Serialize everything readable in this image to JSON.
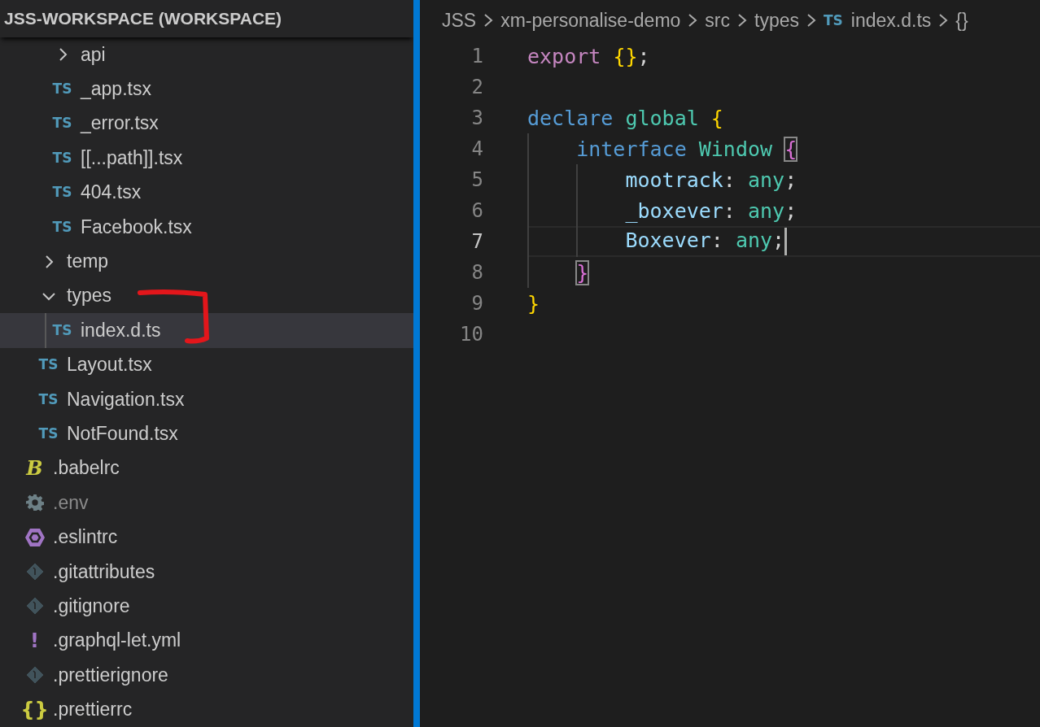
{
  "explorer": {
    "title": "JSS-WORKSPACE (WORKSPACE)",
    "tree": [
      {
        "children": [
          {
            "children": [
              {
                "label": "api",
                "kind": "folder",
                "expanded": false,
                "selected": false,
                "dimmed": false
              },
              {
                "label": "_app.tsx",
                "kind": "file",
                "icon": {
                  "kind": "ts",
                  "glyph": "TS"
                },
                "selected": false,
                "dimmed": false
              },
              {
                "label": "_error.tsx",
                "kind": "file",
                "icon": {
                  "kind": "ts",
                  "glyph": "TS"
                },
                "selected": false,
                "dimmed": false
              },
              {
                "label": "[[...path]].tsx",
                "kind": "file",
                "icon": {
                  "kind": "ts",
                  "glyph": "TS"
                },
                "selected": false,
                "dimmed": false
              },
              {
                "label": "404.tsx",
                "kind": "file",
                "icon": {
                  "kind": "ts",
                  "glyph": "TS"
                },
                "selected": false,
                "dimmed": false
              },
              {
                "label": "Facebook.tsx",
                "kind": "file",
                "icon": {
                  "kind": "ts",
                  "glyph": "TS"
                },
                "selected": false,
                "dimmed": false
              }
            ]
          },
          {
            "label": "temp",
            "kind": "folder",
            "expanded": false,
            "selected": false,
            "dimmed": false
          },
          {
            "label": "types",
            "kind": "folder",
            "expanded": true,
            "selected": false,
            "dimmed": false,
            "children": [
              {
                "label": "index.d.ts",
                "kind": "file",
                "icon": {
                  "kind": "ts",
                  "glyph": "TS"
                },
                "selected": true,
                "dimmed": false
              }
            ]
          },
          {
            "label": "Layout.tsx",
            "kind": "file",
            "icon": {
              "kind": "ts",
              "glyph": "TS"
            },
            "selected": false,
            "dimmed": false
          },
          {
            "label": "Navigation.tsx",
            "kind": "file",
            "icon": {
              "kind": "ts",
              "glyph": "TS"
            },
            "selected": false,
            "dimmed": false
          },
          {
            "label": "NotFound.tsx",
            "kind": "file",
            "icon": {
              "kind": "ts",
              "glyph": "TS"
            },
            "selected": false,
            "dimmed": false
          }
        ]
      },
      {
        "label": ".babelrc",
        "kind": "file",
        "icon": {
          "kind": "babel",
          "glyph": "B"
        },
        "selected": false,
        "dimmed": false
      },
      {
        "label": ".env",
        "kind": "file",
        "icon": {
          "kind": "gear"
        },
        "selected": false,
        "dimmed": true
      },
      {
        "label": ".eslintrc",
        "kind": "file",
        "icon": {
          "kind": "eslint"
        },
        "selected": false,
        "dimmed": false
      },
      {
        "label": ".gitattributes",
        "kind": "file",
        "icon": {
          "kind": "git"
        },
        "selected": false,
        "dimmed": false
      },
      {
        "label": ".gitignore",
        "kind": "file",
        "icon": {
          "kind": "git"
        },
        "selected": false,
        "dimmed": false
      },
      {
        "label": ".graphql-let.yml",
        "kind": "file",
        "icon": {
          "kind": "yaml",
          "glyph": "!"
        },
        "selected": false,
        "dimmed": false
      },
      {
        "label": ".prettierignore",
        "kind": "file",
        "icon": {
          "kind": "git"
        },
        "selected": false,
        "dimmed": false
      },
      {
        "label": ".prettierrc",
        "kind": "file",
        "icon": {
          "kind": "json",
          "glyph": "{}"
        },
        "selected": false,
        "dimmed": false
      }
    ]
  },
  "editor": {
    "breadcrumbs": [
      {
        "label": "JSS"
      },
      {
        "label": "xm-personalise-demo"
      },
      {
        "label": "src"
      },
      {
        "label": "types"
      },
      {
        "label": "index.d.ts",
        "icon": {
          "kind": "ts",
          "glyph": "TS"
        }
      },
      {
        "label": "{}"
      }
    ],
    "lines": [
      {
        "number": "1",
        "current": false,
        "tokens": [
          {
            "text": "export",
            "kind": "control"
          },
          {
            "text": " {}",
            "kind": "brace1"
          },
          {
            "text": ";",
            "kind": "plain"
          }
        ]
      },
      {
        "number": "2",
        "current": false
      },
      {
        "number": "3",
        "current": false,
        "tokens": [
          {
            "text": "declare",
            "kind": "keyword"
          },
          {
            "text": " global",
            "kind": "type"
          },
          {
            "text": " {",
            "kind": "brace1"
          }
        ]
      },
      {
        "number": "4",
        "current": false,
        "tokens": [
          {
            "text": "    interface",
            "kind": "keyword"
          },
          {
            "text": " Window",
            "kind": "type"
          },
          {
            "text": " {",
            "kind": "brace2_matched"
          }
        ]
      },
      {
        "number": "5",
        "current": false,
        "tokens": [
          {
            "text": "        mootrack",
            "kind": "property"
          },
          {
            "text": ":",
            "kind": "plain"
          },
          {
            "text": " any",
            "kind": "type"
          },
          {
            "text": ";",
            "kind": "plain"
          }
        ]
      },
      {
        "number": "6",
        "current": false,
        "tokens": [
          {
            "text": "        _boxever",
            "kind": "property"
          },
          {
            "text": ":",
            "kind": "plain"
          },
          {
            "text": " any",
            "kind": "type"
          },
          {
            "text": ";",
            "kind": "plain"
          }
        ]
      },
      {
        "number": "7",
        "current": true,
        "tokens": [
          {
            "text": "        Boxever",
            "kind": "property"
          },
          {
            "text": ":",
            "kind": "plain"
          },
          {
            "text": " any",
            "kind": "type"
          },
          {
            "text": ";",
            "kind": "plain"
          }
        ]
      },
      {
        "number": "8",
        "current": false,
        "tokens": [
          {
            "text": "    }",
            "kind": "brace2_matched"
          }
        ]
      },
      {
        "number": "9",
        "current": false,
        "tokens": [
          {
            "text": "}",
            "kind": "brace1"
          }
        ]
      },
      {
        "number": "10",
        "current": false
      }
    ]
  }
}
